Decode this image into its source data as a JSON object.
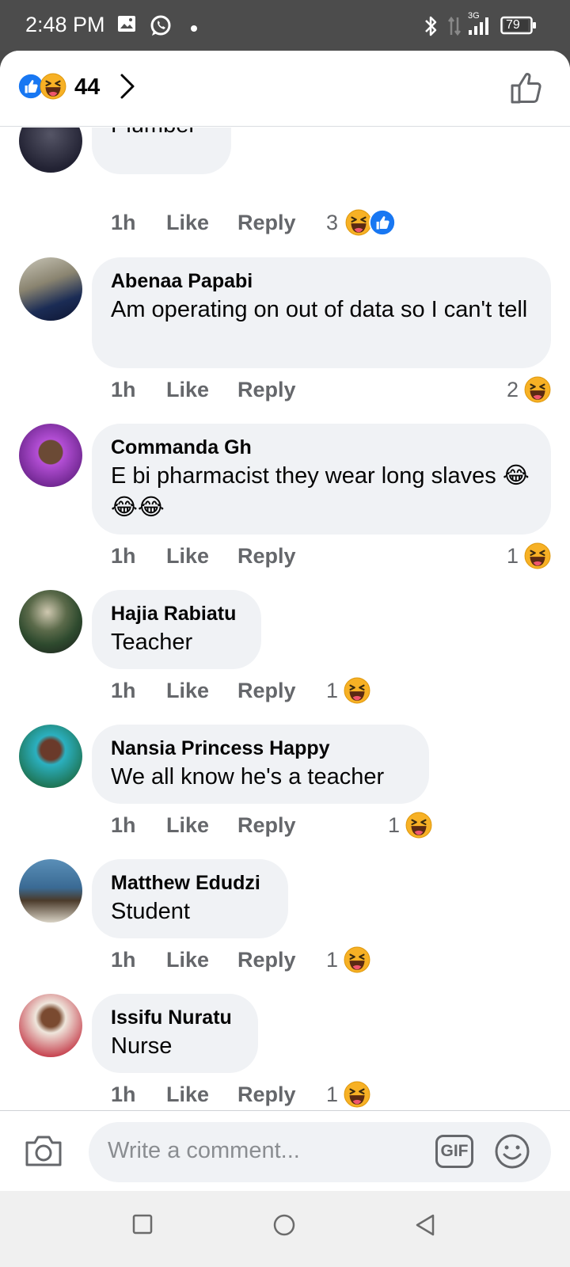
{
  "status_bar": {
    "time": "2:48 PM",
    "network": "3G",
    "battery": "79"
  },
  "header": {
    "reaction_count": "44",
    "reactions": [
      "like-icon",
      "haha-icon"
    ]
  },
  "comments": [
    {
      "author": "",
      "text": "Plumber",
      "time": "1h",
      "like_label": "Like",
      "reply_label": "Reply",
      "reaction_count": "3",
      "reactions": [
        "haha-icon",
        "like-icon"
      ]
    },
    {
      "author": "Abenaa Papabi",
      "text": "Am operating on out of data so I can't tell",
      "time": "1h",
      "like_label": "Like",
      "reply_label": "Reply",
      "reaction_count": "2",
      "reactions": [
        "haha-icon"
      ]
    },
    {
      "author": "Commanda Gh",
      "text": "E bi pharmacist they wear long slaves 😂😂😂",
      "time": "1h",
      "like_label": "Like",
      "reply_label": "Reply",
      "reaction_count": "1",
      "reactions": [
        "haha-icon"
      ]
    },
    {
      "author": "Hajia Rabiatu",
      "text": "Teacher",
      "time": "1h",
      "like_label": "Like",
      "reply_label": "Reply",
      "reaction_count": "1",
      "reactions": [
        "haha-icon"
      ]
    },
    {
      "author": "Nansia Princess Happy",
      "text": "We all know he's a teacher",
      "time": "1h",
      "like_label": "Like",
      "reply_label": "Reply",
      "reaction_count": "1",
      "reactions": [
        "haha-icon"
      ]
    },
    {
      "author": "Matthew Edudzi",
      "text": "Student",
      "time": "1h",
      "like_label": "Like",
      "reply_label": "Reply",
      "reaction_count": "1",
      "reactions": [
        "haha-icon"
      ]
    },
    {
      "author": "Issifu Nuratu",
      "text": "Nurse",
      "time": "1h",
      "like_label": "Like",
      "reply_label": "Reply",
      "reaction_count": "1",
      "reactions": [
        "haha-icon"
      ]
    }
  ],
  "composer": {
    "placeholder": "Write a comment...",
    "gif_label": "GIF"
  },
  "colors": {
    "accent": "#1877f2",
    "haha": "#f7b125",
    "bubble": "#f0f2f5",
    "secondary_text": "#65676b"
  }
}
